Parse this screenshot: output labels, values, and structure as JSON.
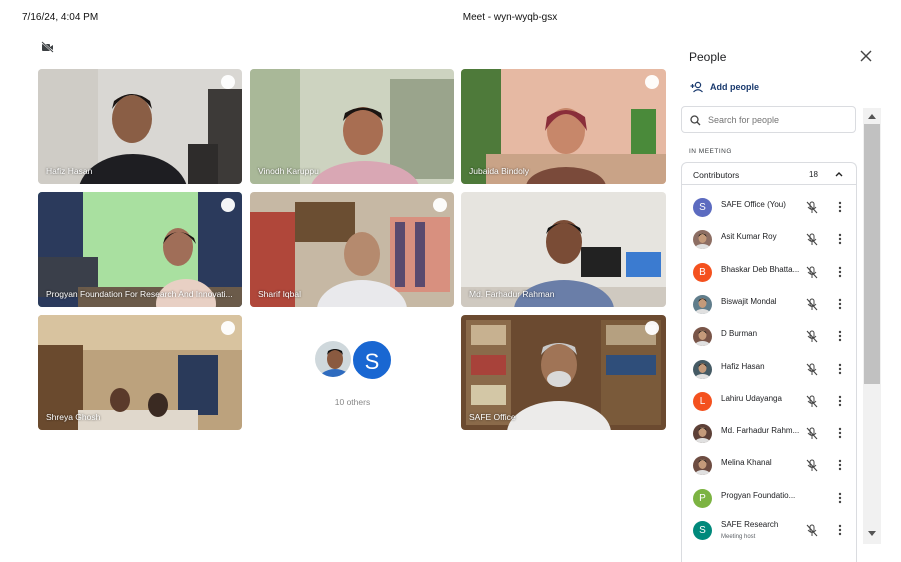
{
  "topbar": {
    "datetime": "7/16/24, 4:04 PM",
    "title": "Meet - wyn-wyqb-gsx"
  },
  "tiles": [
    {
      "name": "Hafiz Hasan"
    },
    {
      "name": "Vinodh Karuppu"
    },
    {
      "name": "Jubaida Bindoly"
    },
    {
      "name": "Progyan Foundation For Research And Innovati..."
    },
    {
      "name": "Sharif Iqbal"
    },
    {
      "name": "Md. Farhadur Rahman"
    },
    {
      "name": "Shreya Ghosh"
    },
    {
      "name": "SAFE Office"
    }
  ],
  "others": {
    "avatar_letter": "S",
    "label": "10 others"
  },
  "panel": {
    "title": "People",
    "add_people": "Add people",
    "search_placeholder": "Search for people",
    "section_label": "IN MEETING",
    "group": {
      "label": "Contributors",
      "count": "18"
    },
    "participants": [
      {
        "name": "SAFE Office (You)",
        "letter": "S",
        "color": "#5c6bc0"
      },
      {
        "name": "Asit Kumar Roy",
        "letter": "",
        "color": "#8d6e63"
      },
      {
        "name": "Bhaskar Deb Bhatta...",
        "letter": "B",
        "color": "#f4511e"
      },
      {
        "name": "Biswajit Mondal",
        "letter": "",
        "color": "#607d8b"
      },
      {
        "name": "D Burman",
        "letter": "",
        "color": "#795548"
      },
      {
        "name": "Hafiz Hasan",
        "letter": "",
        "color": "#455a64"
      },
      {
        "name": "Lahiru Udayanga",
        "letter": "L",
        "color": "#f4511e"
      },
      {
        "name": "Md. Farhadur Rahm...",
        "letter": "",
        "color": "#5d4037"
      },
      {
        "name": "Melina Khanal",
        "letter": "",
        "color": "#6d4c41"
      },
      {
        "name": "Progyan Foundatio...",
        "letter": "P",
        "color": "#7cb342"
      },
      {
        "name": "SAFE Research",
        "letter": "S",
        "color": "#00897b",
        "sub": "Meeting host"
      }
    ]
  }
}
